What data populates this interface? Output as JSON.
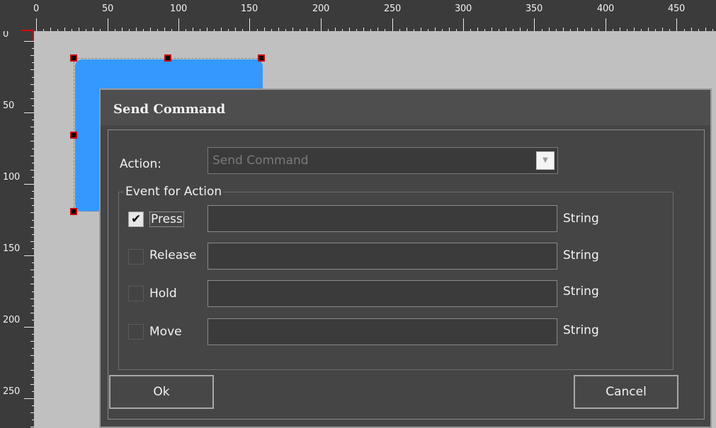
{
  "ruler": {
    "h_labels": [
      "0",
      "50",
      "100",
      "150",
      "200",
      "250",
      "300",
      "350",
      "400",
      "450"
    ],
    "v_labels": [
      "0",
      "50",
      "100",
      "150",
      "200",
      "250"
    ]
  },
  "dialog": {
    "title": "Send Command",
    "action_label": "Action:",
    "action_value": "Send Command",
    "action_arrow": "▼",
    "event_group_label": "Event for Action",
    "events": [
      {
        "label": "Press",
        "checked": true,
        "value": "",
        "type": "String"
      },
      {
        "label": "Release",
        "checked": false,
        "value": "",
        "type": "String"
      },
      {
        "label": "Hold",
        "checked": false,
        "value": "",
        "type": "String"
      },
      {
        "label": "Move",
        "checked": false,
        "value": "",
        "type": "String"
      }
    ],
    "check_mark": "✔",
    "ok_label": "Ok",
    "cancel_label": "Cancel"
  },
  "colors": {
    "shape_fill": "#3399ff",
    "dialog_bg": "#454545",
    "ruler_bg": "#3b3b3b",
    "canvas_bg": "#c0c0c0"
  }
}
